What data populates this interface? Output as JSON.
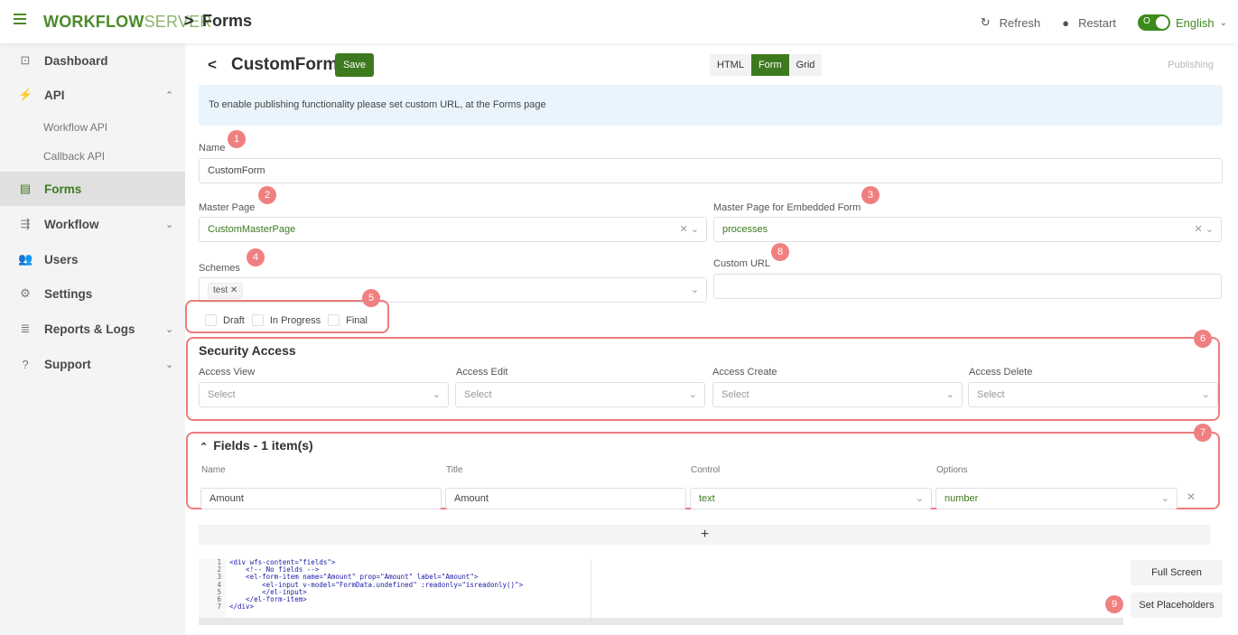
{
  "header": {
    "logo_bold": "WORKFLOW",
    "logo_light": "SERVER",
    "separator": ">",
    "page": "Forms",
    "refresh": "Refresh",
    "restart": "Restart",
    "toggle_text": "O",
    "language": "English"
  },
  "sidebar": {
    "dashboard": "Dashboard",
    "api": "API",
    "workflow_api": "Workflow API",
    "callback_api": "Callback API",
    "forms": "Forms",
    "workflow": "Workflow",
    "users": "Users",
    "settings": "Settings",
    "reports": "Reports & Logs",
    "support": "Support"
  },
  "form": {
    "back": "<",
    "title": "CustomForm",
    "save": "Save",
    "views": [
      "HTML",
      "Form",
      "Grid"
    ],
    "active_view": "Form",
    "publishing": "Publishing",
    "info": "To enable publishing functionality please set custom URL, at the Forms page",
    "name_label": "Name",
    "name_value": "CustomForm",
    "master_page_label": "Master Page",
    "master_page_value": "CustomMasterPage",
    "embedded_label": "Master Page for Embedded Form",
    "embedded_value": "processes",
    "schemes_label": "Schemes",
    "scheme_tag": "test",
    "custom_url_label": "Custom URL",
    "custom_url_value": "",
    "statuses": [
      "Draft",
      "In Progress",
      "Final"
    ]
  },
  "security": {
    "title": "Security Access",
    "view_label": "Access View",
    "edit_label": "Access Edit",
    "create_label": "Access Create",
    "delete_label": "Access Delete",
    "placeholder": "Select"
  },
  "fields": {
    "title": "Fields - 1 item(s)",
    "col_name": "Name",
    "col_title": "Title",
    "col_control": "Control",
    "col_options": "Options",
    "row_name": "Amount",
    "row_title": "Amount",
    "row_control": "text",
    "row_options": "number",
    "add": "+"
  },
  "code": {
    "line_numbers": "1\n2\n3\n4\n5\n6\n7",
    "lines": "<div wfs-content=\"fields\">\n    <!-- No fields -->\n    <el-form-item name=\"Amount\" prop=\"Amount\" label=\"Amount\">\n        <el-input v-model=\"FormData.undefined\" :readonly=\"isreadonly()\">\n        </el-input>\n    </el-form-item>\n</div>"
  },
  "actions": {
    "full_screen": "Full Screen",
    "set_placeholders": "Set Placeholders"
  },
  "badges": [
    "1",
    "2",
    "3",
    "4",
    "5",
    "6",
    "7",
    "8",
    "9"
  ]
}
